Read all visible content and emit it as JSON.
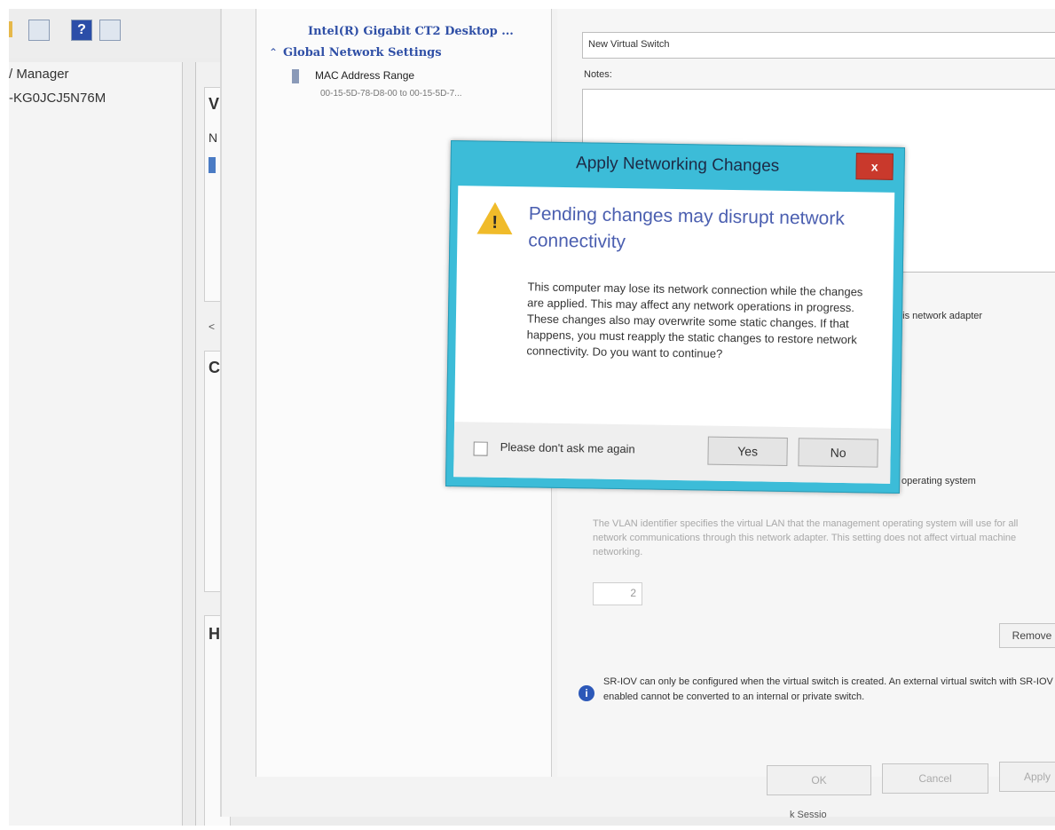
{
  "left_pane": {
    "tree_title": "/ Manager",
    "tree_host": "-KG0JCJ5N76M",
    "section_letters": [
      "V",
      "N",
      "C",
      "H"
    ],
    "scroll_left": "<"
  },
  "switch_manager": {
    "adapter_name": "Intel(R) Gigabit CT2 Desktop ...",
    "global_settings": "Global Network Settings",
    "mac_range_label": "MAC Address Range",
    "mac_range_value": "00-15-5D-78-D8-00 to 00-15-5D-7...",
    "name_value": "New Virtual Switch",
    "notes_label": "Notes:",
    "adapter_option": "this network adapter",
    "os_option": "operating system",
    "vlan_blurred": "The VLAN identifier specifies the virtual LAN that the management operating system will use for all network communications through this network adapter. This setting does not affect virtual machine networking.",
    "vlan_value": "2",
    "remove_button": "Remove",
    "sriov_note": "SR-IOV can only be configured when the virtual switch is created. An external virtual switch with SR-IOV enabled cannot be converted to an internal or private switch.",
    "ok_button": "OK",
    "cancel_button": "Cancel",
    "apply_button": "Apply",
    "bottom_fragment": "k Sessio"
  },
  "dialog": {
    "title": "Apply Networking Changes",
    "close_glyph": "x",
    "heading": "Pending changes may disrupt network connectivity",
    "message": "This computer may lose its network connection while the changes are applied. This may affect any network operations in progress. These changes also may overwrite some static changes. If that happens, you must reapply the static changes to restore network connectivity. Do you want to continue?",
    "checkbox_label": "Please don't ask me again",
    "yes_button": "Yes",
    "no_button": "No"
  },
  "icons": [
    "folder-icon",
    "properties-icon",
    "help-icon",
    "view-icon",
    "warning-icon",
    "info-icon",
    "adapter-icon",
    "collapse-icon"
  ],
  "colors": {
    "dialog_frame": "#3cbcd8",
    "close_button": "#c9392c",
    "heading": "#4b5fb0",
    "warning": "#f0bb2a"
  }
}
